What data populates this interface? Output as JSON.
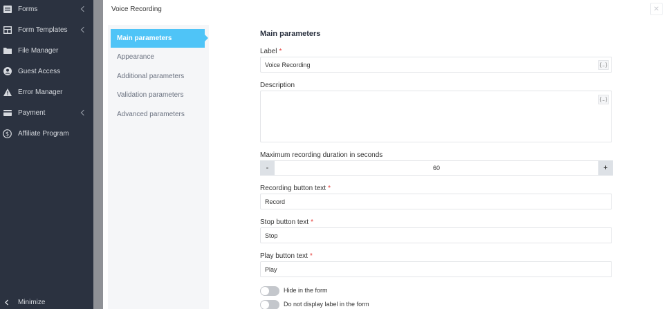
{
  "sidebar": {
    "items": [
      {
        "label": "Forms",
        "icon": "forms-icon",
        "has_submenu": true
      },
      {
        "label": "Form Templates",
        "icon": "form-templates-icon",
        "has_submenu": true
      },
      {
        "label": "File Manager",
        "icon": "file-manager-icon",
        "has_submenu": false
      },
      {
        "label": "Guest Access",
        "icon": "guest-access-icon",
        "has_submenu": false
      },
      {
        "label": "Error Manager",
        "icon": "warning-icon",
        "has_submenu": false
      },
      {
        "label": "Payment",
        "icon": "payment-icon",
        "has_submenu": true
      },
      {
        "label": "Affiliate Program",
        "icon": "dollar-icon",
        "has_submenu": false
      }
    ],
    "minimize_label": "Minimize"
  },
  "window": {
    "title": "Voice Recording",
    "close_glyph": "✕"
  },
  "tabs": [
    {
      "label": "Main parameters",
      "active": true
    },
    {
      "label": "Appearance",
      "active": false
    },
    {
      "label": "Additional parameters",
      "active": false
    },
    {
      "label": "Validation parameters",
      "active": false
    },
    {
      "label": "Advanced parameters",
      "active": false
    }
  ],
  "form": {
    "section_title": "Main parameters",
    "label": {
      "label": "Label",
      "required_mark": "*",
      "value": "Voice Recording",
      "var_btn": "{...}"
    },
    "description": {
      "label": "Description",
      "value": "",
      "var_btn": "{...}"
    },
    "duration": {
      "label": "Maximum recording duration in seconds",
      "minus": "-",
      "plus": "+",
      "value": "60"
    },
    "record_text": {
      "label": "Recording button text",
      "required_mark": "*",
      "value": "Record"
    },
    "stop_text": {
      "label": "Stop button text",
      "required_mark": "*",
      "value": "Stop"
    },
    "play_text": {
      "label": "Play button text",
      "required_mark": "*",
      "value": "Play"
    },
    "toggles": [
      {
        "label": "Hide in the form",
        "on": false
      },
      {
        "label": "Do not display label in the form",
        "on": false
      }
    ]
  },
  "colors": {
    "sidebar_bg": "#2b3240",
    "accent": "#4fc4f7",
    "required": "#e53935"
  }
}
